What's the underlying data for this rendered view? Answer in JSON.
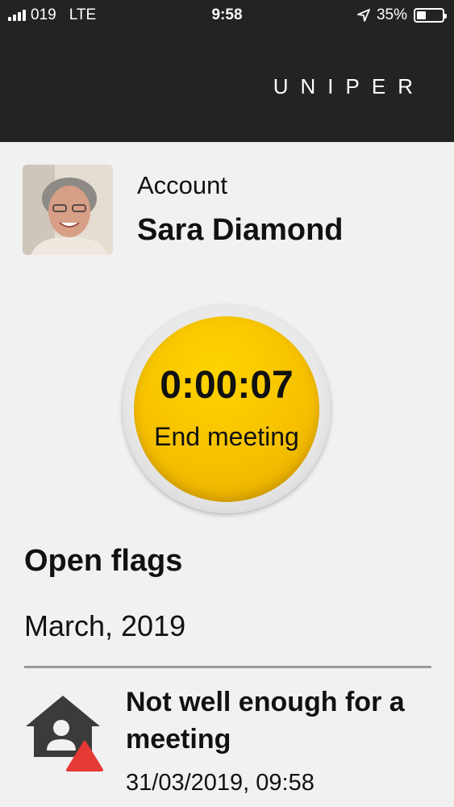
{
  "status_bar": {
    "carrier": "019",
    "network": "LTE",
    "time": "9:58",
    "battery": "35%",
    "battery_level": 0.35
  },
  "header": {
    "brand": "UNIPER"
  },
  "account": {
    "label": "Account",
    "name": "Sara Diamond"
  },
  "meeting": {
    "timer": "0:00:07",
    "end_label": "End meeting"
  },
  "flags": {
    "title": "Open flags",
    "month": "March, 2019",
    "items": [
      {
        "title": "Not well enough for a meeting",
        "timestamp": "31/03/2019, 09:58",
        "icon": "home-alert-icon"
      }
    ]
  },
  "colors": {
    "header_bg": "#232323",
    "page_bg": "#f1f1f1",
    "button_yellow": "#f5bf00",
    "alert_red": "#e53935"
  }
}
